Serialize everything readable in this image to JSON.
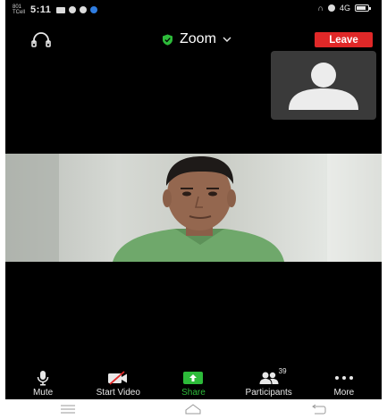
{
  "status_bar": {
    "carrier": "801 TCell",
    "time": "5:11",
    "right_label": "4G"
  },
  "meeting": {
    "title": "Zoom",
    "leave_label": "Leave",
    "colors": {
      "leave": "#e02828",
      "shield": "#2dbb3a",
      "share": "#2dbb3a"
    }
  },
  "toolbar": {
    "mute_label": "Mute",
    "start_video_label": "Start Video",
    "share_label": "Share",
    "participants_label": "Participants",
    "participants_count": "39",
    "more_label": "More"
  },
  "icons": {
    "audio": "headphone-icon",
    "shield": "shield-check-icon",
    "dropdown": "chevron-down-icon",
    "mute": "microphone-icon",
    "video": "video-off-icon",
    "share": "share-arrow-icon",
    "participants": "people-icon",
    "more": "dots-icon",
    "nav_menu": "menu-icon",
    "nav_home": "home-icon",
    "nav_back": "back-icon"
  }
}
